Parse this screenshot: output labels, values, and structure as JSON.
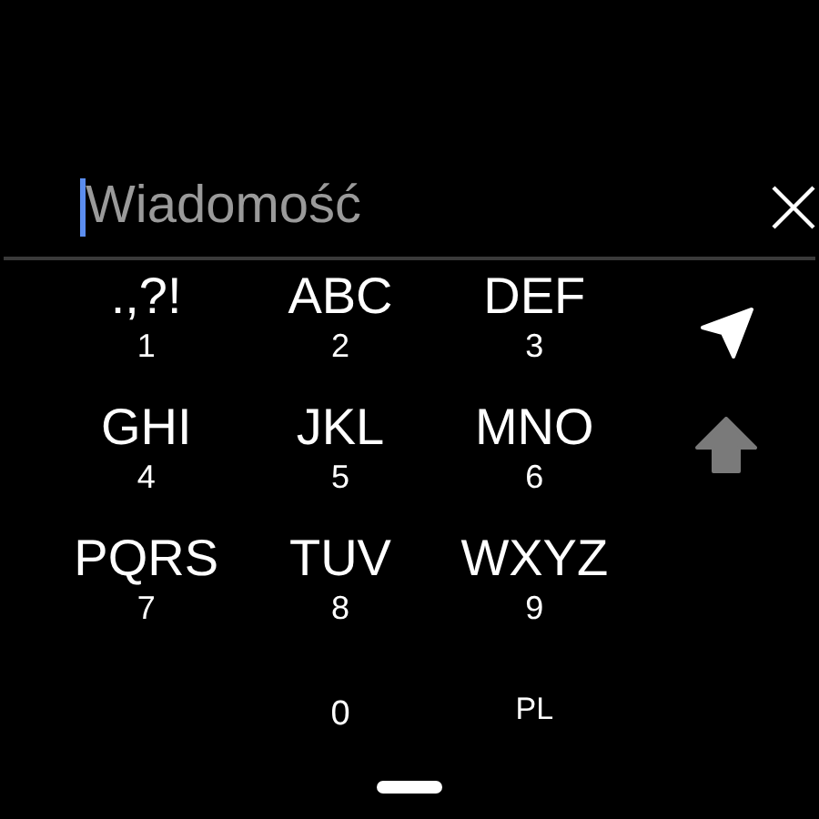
{
  "message_field": {
    "placeholder": "Wiadomość",
    "focused": true
  },
  "keys": [
    {
      "kind": "key",
      "letters": ".,?!",
      "digit": "1"
    },
    {
      "kind": "key",
      "letters": "ABC",
      "digit": "2"
    },
    {
      "kind": "key",
      "letters": "DEF",
      "digit": "3"
    },
    {
      "kind": "key",
      "letters": "GHI",
      "digit": "4"
    },
    {
      "kind": "key",
      "letters": "JKL",
      "digit": "5"
    },
    {
      "kind": "key",
      "letters": "MNO",
      "digit": "6"
    },
    {
      "kind": "key",
      "letters": "PQRS",
      "digit": "7"
    },
    {
      "kind": "key",
      "letters": "TUV",
      "digit": "8"
    },
    {
      "kind": "key",
      "letters": "WXYZ",
      "digit": "9"
    },
    {
      "kind": "empty"
    },
    {
      "kind": "digit",
      "digit": "0"
    },
    {
      "kind": "language",
      "label": "PL"
    }
  ],
  "shift": {
    "on": false
  }
}
